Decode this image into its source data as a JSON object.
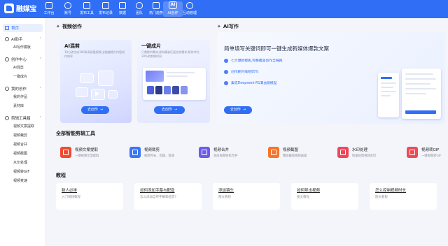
{
  "app": {
    "logo_text": "融媒宝"
  },
  "topnav": [
    {
      "label": "工作台",
      "icon": "workbench-icon"
    },
    {
      "label": "账号",
      "icon": "account-icon"
    },
    {
      "label": "发布工具",
      "icon": "publish-icon"
    },
    {
      "label": "发布记录",
      "icon": "record-icon"
    },
    {
      "label": "数据",
      "icon": "data-icon"
    },
    {
      "label": "团队",
      "icon": "team-icon"
    },
    {
      "label": "热门趋势",
      "icon": "trend-icon"
    },
    {
      "label": "AI创作",
      "icon": "ai-icon",
      "badge": "AI"
    },
    {
      "label": "互动管理",
      "icon": "interact-icon"
    }
  ],
  "sidebar": {
    "home": "首页",
    "groups": [
      {
        "label": "AI助手",
        "items": [
          "AI写作模板"
        ]
      },
      {
        "label": "创作中心",
        "items": [
          "AI混剪",
          "一键成片"
        ]
      },
      {
        "label": "我的创作",
        "items": [
          "我的作品",
          "素材库"
        ]
      },
      {
        "label": "剪辑工具箱",
        "items": [
          "视频文案提取",
          "视频裁剪",
          "视频合并",
          "视频截图",
          "水印处理",
          "视频转GIF",
          "视频变速"
        ]
      }
    ]
  },
  "video_section": {
    "title": "视频创作",
    "cards": [
      {
        "title": "AI混剪",
        "desc": "10分钟生成100条高质量视频,全链路提升内容创作效率",
        "button": "去创作"
      },
      {
        "title": "一键成片",
        "desc": "只需提供素材,即刻精准匹配创作需求,帮你节约30%的剪辑时间",
        "button": "去创作"
      }
    ]
  },
  "ai_write": {
    "section_title": "AI写作",
    "headline": "简单填写关键词即可一键生成新媒体爆款文案",
    "features": [
      "七大爆款模板,完整覆盖创作全链路",
      "创作耗时缩短95%",
      "集成Deepseek-R1满血版模型"
    ],
    "button": "去创作"
  },
  "tools_section": {
    "title": "全部智能剪辑工具",
    "tools": [
      {
        "name": "视频文案提取",
        "desc": "一键视频文案提取",
        "color": "#f04b32"
      },
      {
        "name": "视频裁剪",
        "desc": "视频时长、剪辑、变速",
        "color": "#3a76f5"
      },
      {
        "name": "视频合并",
        "desc": "多段视频轻松合并",
        "color": "#6b5cf0"
      },
      {
        "name": "视频截图",
        "desc": "精准截取视频画面",
        "color": "#f7742a"
      },
      {
        "name": "水印处理",
        "desc": "快速处理视频水印",
        "color": "#f0455a"
      },
      {
        "name": "视频转GIF",
        "desc": "一键视频转GIF",
        "color": "#ef4a55"
      }
    ]
  },
  "tutorial_section": {
    "title": "教程",
    "items": [
      {
        "title": "新人必学",
        "desc": "入门视频教程"
      },
      {
        "title": "如何添加字幕与配音",
        "desc": "怎么添加自带字幕和配音?"
      },
      {
        "title": "添加镜头",
        "desc": "图文教程"
      },
      {
        "title": "如何导出视频",
        "desc": "图文教程"
      },
      {
        "title": "怎么控制视频时长",
        "desc": "图文教程"
      }
    ]
  },
  "colors": {
    "primary": "#2f6ef5",
    "bg": "#f3f5fa"
  }
}
